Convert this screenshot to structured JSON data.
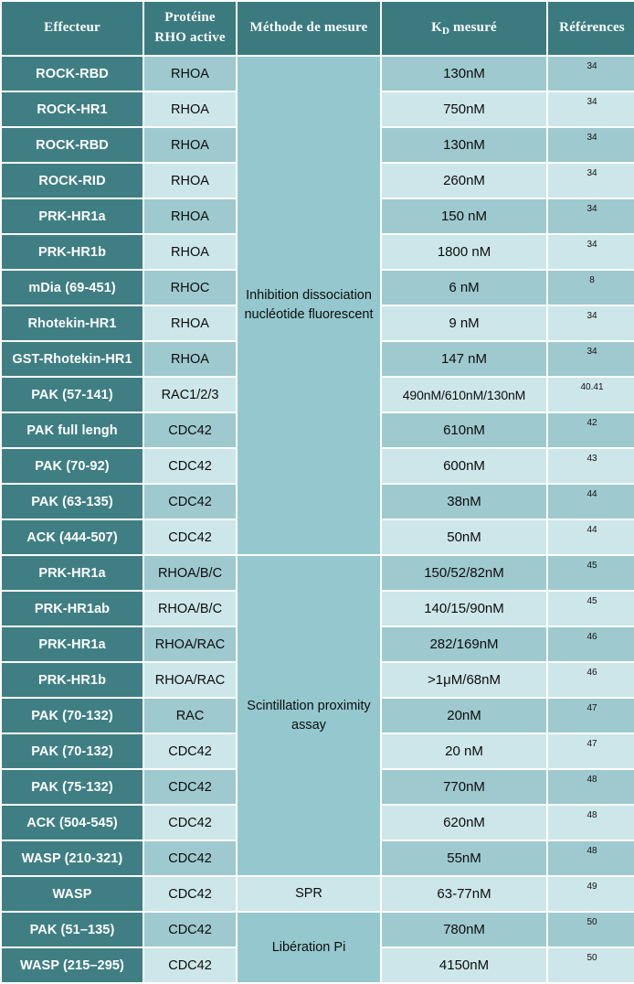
{
  "table": {
    "headers": [
      "Effecteur",
      "Protéine RHO active",
      "Méthode de mesure",
      "KD mesuré",
      "Références"
    ],
    "header_kd_base": "K",
    "header_kd_sub": "D",
    "header_kd_rest": " mesuré",
    "methods": [
      "Inhibition dissociation nucléotide fluorescent",
      "Scintillation proximity assay",
      "SPR",
      "Libération Pi"
    ],
    "rows": [
      {
        "effector": "ROCK-RBD",
        "protein": "RHOA",
        "kd": "130nM",
        "reference": "34"
      },
      {
        "effector": "ROCK-HR1",
        "protein": "RHOA",
        "kd": "750nM",
        "reference": "34"
      },
      {
        "effector": "ROCK-RBD",
        "protein": "RHOA",
        "kd": "130nM",
        "reference": "34"
      },
      {
        "effector": "ROCK-RID",
        "protein": "RHOA",
        "kd": "260nM",
        "reference": "34"
      },
      {
        "effector": "PRK-HR1a",
        "protein": "RHOA",
        "kd": "150 nM",
        "reference": "34"
      },
      {
        "effector": "PRK-HR1b",
        "protein": "RHOA",
        "kd": "1800 nM",
        "reference": "34"
      },
      {
        "effector": "mDia (69-451)",
        "protein": "RHOC",
        "kd": "6 nM",
        "reference": "8"
      },
      {
        "effector": "Rhotekin-HR1",
        "protein": "RHOA",
        "kd": "9 nM",
        "reference": "34"
      },
      {
        "effector": "GST-Rhotekin-HR1",
        "protein": "RHOA",
        "kd": "147 nM",
        "reference": "34"
      },
      {
        "effector": "PAK (57-141)",
        "protein": "RAC1/2/3",
        "kd": "490nM/610nM/130nM",
        "reference": "40.41"
      },
      {
        "effector": "PAK full lengh",
        "protein": "CDC42",
        "kd": "610nM",
        "reference": "42"
      },
      {
        "effector": "PAK (70-92)",
        "protein": "CDC42",
        "kd": "600nM",
        "reference": "43"
      },
      {
        "effector": "PAK (63-135)",
        "protein": "CDC42",
        "kd": "38nM",
        "reference": "44"
      },
      {
        "effector": "ACK (444-507)",
        "protein": "CDC42",
        "kd": "50nM",
        "reference": "44"
      },
      {
        "effector": "PRK-HR1a",
        "protein": "RHOA/B/C",
        "kd": "150/52/82nM",
        "reference": "45"
      },
      {
        "effector": "PRK-HR1ab",
        "protein": "RHOA/B/C",
        "kd": "140/15/90nM",
        "reference": "45"
      },
      {
        "effector": "PRK-HR1a",
        "protein": "RHOA/RAC",
        "kd": "282/169nM",
        "reference": "46"
      },
      {
        "effector": "PRK-HR1b",
        "protein": "RHOA/RAC",
        "kd": ">1μM/68nM",
        "reference": "46"
      },
      {
        "effector": "PAK (70-132)",
        "protein": "RAC",
        "kd": "20nM",
        "reference": "47"
      },
      {
        "effector": "PAK (70-132)",
        "protein": "CDC42",
        "kd": "20 nM",
        "reference": "47"
      },
      {
        "effector": "PAK (75-132)",
        "protein": "CDC42",
        "kd": "770nM",
        "reference": "48"
      },
      {
        "effector": "ACK (504-545)",
        "protein": "CDC42",
        "kd": "620nM",
        "reference": "48"
      },
      {
        "effector": "WASP (210-321)",
        "protein": "CDC42",
        "kd": "55nM",
        "reference": "48"
      },
      {
        "effector": "WASP",
        "protein": "CDC42",
        "kd": "63-77nM",
        "reference": "49"
      },
      {
        "effector": "PAK (51–135)",
        "protein": "CDC42",
        "kd": "780nM",
        "reference": "50"
      },
      {
        "effector": "WASP (215–295)",
        "protein": "CDC42",
        "kd": "4150nM",
        "reference": "50"
      }
    ]
  },
  "colors": {
    "header_bg": "#3b7b80",
    "effector_bg": "#3f7f84",
    "band_dark": "#9ec9cf",
    "band_light": "#cde6e9",
    "method_bg": "#94c8ce",
    "text_dark": "#0d0d0d",
    "text_light": "#ffffff"
  }
}
